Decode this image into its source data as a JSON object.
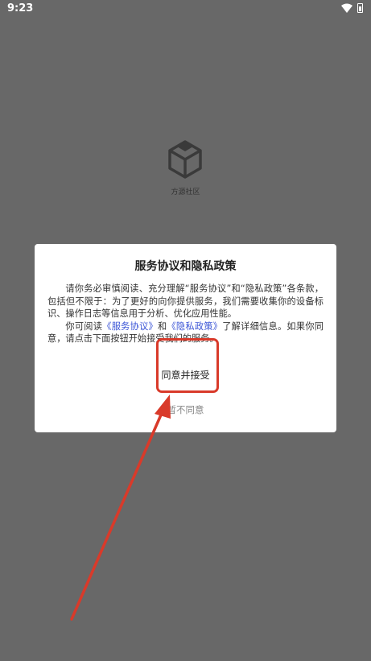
{
  "status_bar": {
    "time": "9:23",
    "wifi_icon": "wifi-icon",
    "battery_icon": "battery-icon"
  },
  "splash": {
    "logo_icon": "box-logo-icon",
    "app_name": "方源社区"
  },
  "dialog": {
    "title": "服务协议和隐私政策",
    "para1": "请你务必审慎阅读、充分理解“服务协议”和“隐私政策”各条款，包括但不限于：为了更好的向你提供服务，我们需要收集你的设备标识、操作日志等信息用于分析、优化应用性能。",
    "para2_prefix": "你可阅读",
    "service_link": "《服务协议》",
    "para2_and": "和",
    "privacy_link": "《隐私政策》",
    "para2_suffix": "了解详细信息。如果你同意，请点击下面按钮开始接受我们的服务。",
    "agree_label": "同意并接受",
    "disagree_label": "暂不同意"
  },
  "annotation": {
    "color": "#d93a2a"
  }
}
